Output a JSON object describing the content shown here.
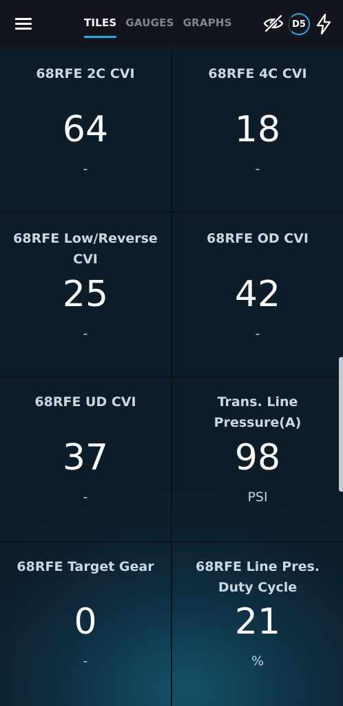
{
  "tabs": [
    {
      "label": "TILES",
      "active": true
    },
    {
      "label": "GAUGES",
      "active": false
    },
    {
      "label": "GRAPHS",
      "active": false
    }
  ],
  "badge": "D5",
  "icons": {
    "menu": "hamburger-menu-icon",
    "visibility": "eye-off-icon",
    "power": "lightning-bolt-icon"
  },
  "colors": {
    "accent": "#29a9e1",
    "topbar": "#13151c",
    "label": "#cbd7e3",
    "value": "#ffffff"
  },
  "tiles": [
    {
      "label": "68RFE 2C CVI",
      "value": "64",
      "unit": "-"
    },
    {
      "label": "68RFE 4C CVI",
      "value": "18",
      "unit": "-"
    },
    {
      "label": "68RFE Low/Reverse CVI",
      "value": "25",
      "unit": "-"
    },
    {
      "label": "68RFE OD CVI",
      "value": "42",
      "unit": "-"
    },
    {
      "label": "68RFE UD CVI",
      "value": "37",
      "unit": "-"
    },
    {
      "label": "Trans. Line Pressure(A)",
      "value": "98",
      "unit": "PSI"
    },
    {
      "label": "68RFE Target Gear",
      "value": "0",
      "unit": "-"
    },
    {
      "label": "68RFE Line Pres. Duty Cycle",
      "value": "21",
      "unit": "%"
    }
  ]
}
